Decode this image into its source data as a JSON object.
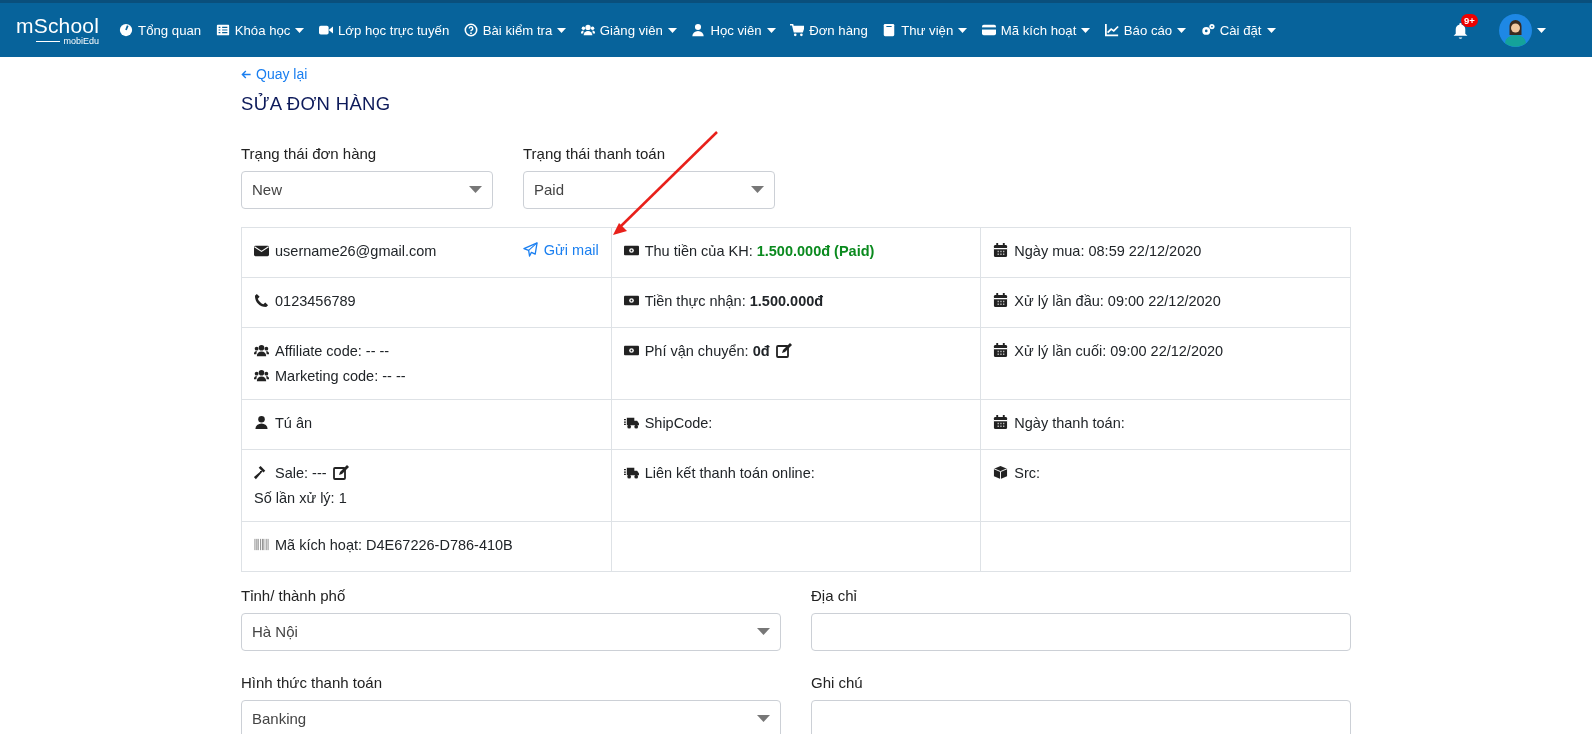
{
  "navbar": {
    "logo": {
      "main": "mSchool",
      "sub": "mobiEdu"
    },
    "items": [
      {
        "label": "Tổng quan",
        "dropdown": false
      },
      {
        "label": "Khóa học",
        "dropdown": true
      },
      {
        "label": "Lớp học trực tuyến",
        "dropdown": false
      },
      {
        "label": "Bài kiểm tra",
        "dropdown": true
      },
      {
        "label": "Giảng viên",
        "dropdown": true
      },
      {
        "label": "Học viên",
        "dropdown": true
      },
      {
        "label": "Đơn hàng",
        "dropdown": false
      },
      {
        "label": "Thư viện",
        "dropdown": true
      },
      {
        "label": "Mã kích hoạt",
        "dropdown": true
      },
      {
        "label": "Báo cáo",
        "dropdown": true
      },
      {
        "label": "Cài đặt",
        "dropdown": true
      }
    ],
    "notification_badge": "9+"
  },
  "back_link": "Quay lại",
  "title": "SỬA ĐƠN HÀNG",
  "status_fields": [
    {
      "label": "Trạng thái đơn hàng",
      "value": "New"
    },
    {
      "label": "Trạng thái thanh toán",
      "value": "Paid"
    }
  ],
  "info_table": {
    "rows": [
      [
        {
          "lines": [
            {
              "text": "username26@gmail.com"
            }
          ],
          "link": "Gửi mail"
        },
        {
          "lines": [
            {
              "text": "Thu tiền của KH: ",
              "value": "1.500.000đ (Paid)",
              "kind": "paid"
            }
          ]
        },
        {
          "lines": [
            {
              "text": "Ngày mua: 08:59 22/12/2020"
            }
          ]
        }
      ],
      [
        {
          "lines": [
            {
              "text": "0123456789"
            }
          ]
        },
        {
          "lines": [
            {
              "text": "Tiền thực nhận: ",
              "value": "1.500.000đ",
              "kind": "amount"
            }
          ]
        },
        {
          "lines": [
            {
              "text": "Xử lý lần đầu: 09:00 22/12/2020"
            }
          ]
        }
      ],
      [
        {
          "lines": [
            {
              "text": "Affiliate code: -- --"
            },
            {
              "text": "Marketing code: -- --"
            }
          ]
        },
        {
          "lines": [
            {
              "text": "Phí vận chuyển: ",
              "value": "0đ",
              "kind": "amount",
              "editable": true
            }
          ]
        },
        {
          "lines": [
            {
              "text": "Xử lý lần cuối: 09:00 22/12/2020"
            }
          ]
        }
      ],
      [
        {
          "lines": [
            {
              "text": "Tú ân"
            }
          ]
        },
        {
          "lines": [
            {
              "text": "ShipCode:"
            }
          ]
        },
        {
          "lines": [
            {
              "text": "Ngày thanh toán:"
            }
          ]
        }
      ],
      [
        {
          "lines": [
            {
              "text": "Sale: ---",
              "editable": true
            },
            {
              "text": "Số lần xử lý: 1"
            }
          ]
        },
        {
          "lines": [
            {
              "text": "Liên kết thanh toán online:"
            }
          ]
        },
        {
          "lines": [
            {
              "text": "Src:"
            }
          ]
        }
      ],
      [
        {
          "lines": [
            {
              "text": "Mã kích hoạt: D4E67226-D786-410B"
            }
          ]
        },
        {},
        {}
      ]
    ]
  },
  "address_fields": [
    {
      "label": "Tỉnh/ thành phố",
      "kind": "select",
      "value": "Hà Nội"
    },
    {
      "label": "Địa chỉ",
      "kind": "input"
    },
    {
      "label": "Hình thức thanh toán",
      "kind": "select",
      "value": "Banking"
    },
    {
      "label": "Ghi chú",
      "kind": "input"
    }
  ]
}
